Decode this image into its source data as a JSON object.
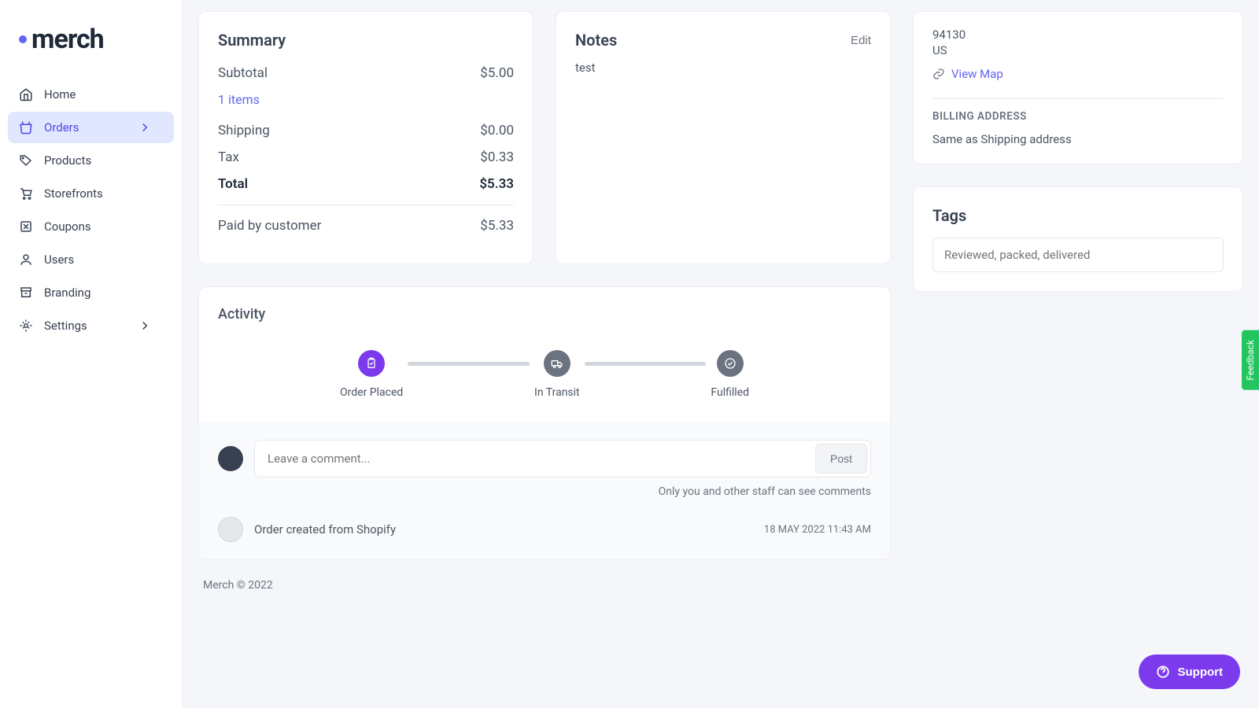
{
  "logo": "merch",
  "nav": [
    {
      "label": "Home"
    },
    {
      "label": "Orders"
    },
    {
      "label": "Products"
    },
    {
      "label": "Storefronts"
    },
    {
      "label": "Coupons"
    },
    {
      "label": "Users"
    },
    {
      "label": "Branding"
    },
    {
      "label": "Settings"
    }
  ],
  "summary": {
    "title": "Summary",
    "subtotal_label": "Subtotal",
    "subtotal_value": "$5.00",
    "items_link": "1 items",
    "shipping_label": "Shipping",
    "shipping_value": "$0.00",
    "tax_label": "Tax",
    "tax_value": "$0.33",
    "total_label": "Total",
    "total_value": "$5.33",
    "paid_label": "Paid by customer",
    "paid_value": "$5.33"
  },
  "notes": {
    "title": "Notes",
    "edit": "Edit",
    "text": "test"
  },
  "address": {
    "zip": "94130",
    "country": "US",
    "view_map": "View Map",
    "billing_heading": "BILLING ADDRESS",
    "billing_text": "Same as Shipping address"
  },
  "tags": {
    "title": "Tags",
    "placeholder": "Reviewed, packed, delivered"
  },
  "activity": {
    "title": "Activity",
    "steps": [
      "Order Placed",
      "In Transit",
      "Fulfilled"
    ],
    "comment_placeholder": "Leave a comment...",
    "post": "Post",
    "hint": "Only you and other staff can see comments",
    "log_text": "Order created from Shopify",
    "log_date": "18 MAY 2022 11:43 AM"
  },
  "footer": "Merch © 2022",
  "support": "Support",
  "feedback": "Feedback"
}
